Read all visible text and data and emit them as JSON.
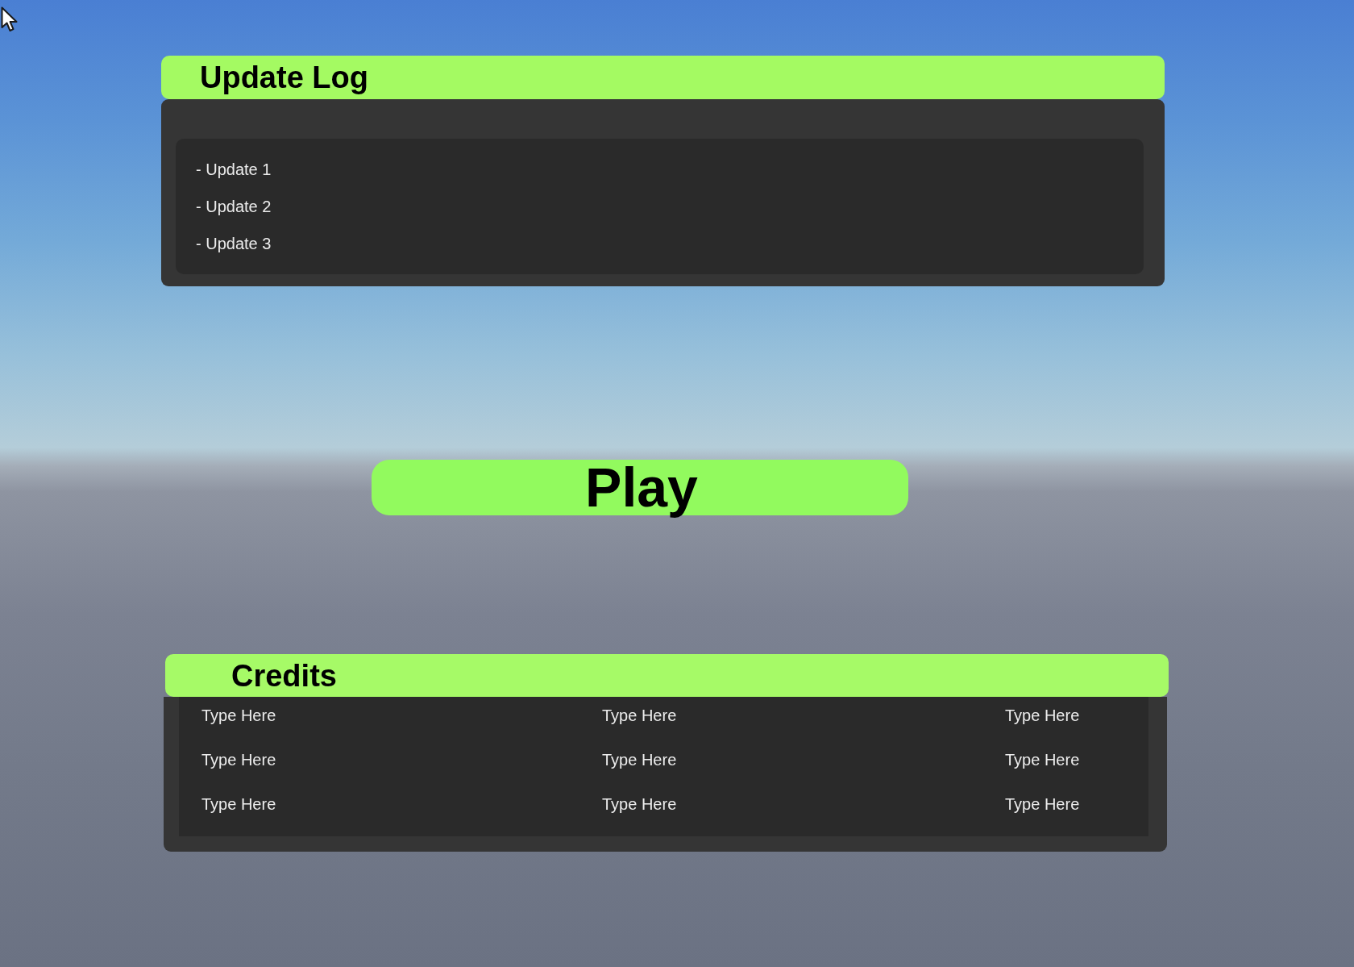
{
  "update_log": {
    "title": "Update Log",
    "entries": [
      "- Update 1",
      "- Update 2",
      "- Update 3"
    ]
  },
  "play_button": {
    "label": "Play"
  },
  "credits": {
    "title": "Credits",
    "rows": [
      [
        "Type Here",
        "Type Here",
        "Type Here"
      ],
      [
        "Type Here",
        "Type Here",
        "Type Here"
      ],
      [
        "Type Here",
        "Type Here",
        "Type Here"
      ]
    ]
  }
}
